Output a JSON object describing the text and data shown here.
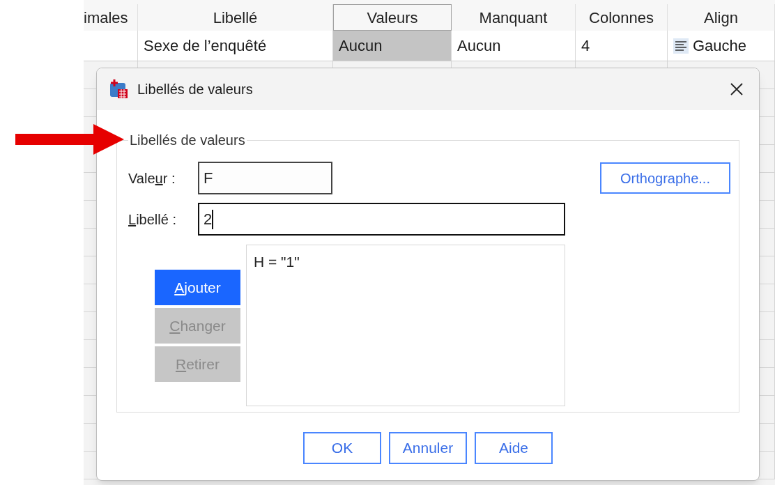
{
  "spreadsheet": {
    "columns": [
      {
        "label": "imales",
        "selected": false
      },
      {
        "label": "Libellé",
        "selected": false
      },
      {
        "label": "Valeurs",
        "selected": true
      },
      {
        "label": "Manquant",
        "selected": false
      },
      {
        "label": "Colonnes",
        "selected": false
      },
      {
        "label": "Align",
        "selected": false
      }
    ],
    "row": [
      {
        "kind": "blank"
      },
      {
        "kind": "text",
        "text": "Sexe de l’enquêté",
        "selected": false
      },
      {
        "kind": "text",
        "text": "Aucun",
        "selected": true
      },
      {
        "kind": "text",
        "text": "Aucun",
        "selected": false
      },
      {
        "kind": "text",
        "text": "4",
        "selected": false
      },
      {
        "kind": "align",
        "text": "Gauche",
        "selected": false
      }
    ]
  },
  "dialog": {
    "title": "Libellés de valeurs",
    "group_title": "Libellés de valeurs",
    "fields": [
      {
        "label": {
          "before": "Vale",
          "key": "u",
          "after": "r :"
        },
        "value": "F",
        "focused": false
      },
      {
        "label": {
          "key": "L",
          "after": "ibellé :"
        },
        "value": "2",
        "focused": true
      }
    ],
    "spelling_button": "Orthographe...",
    "action_buttons": [
      {
        "label": {
          "key": "A",
          "after": "jouter"
        },
        "disabled": false
      },
      {
        "label": {
          "key": "C",
          "after": "hanger"
        },
        "disabled": true
      },
      {
        "label": {
          "key": "R",
          "after": "etirer"
        },
        "disabled": true
      }
    ],
    "value_labels": [
      "H = \"1\""
    ],
    "footer_buttons": [
      "OK",
      "Annuler",
      "Aide"
    ]
  }
}
